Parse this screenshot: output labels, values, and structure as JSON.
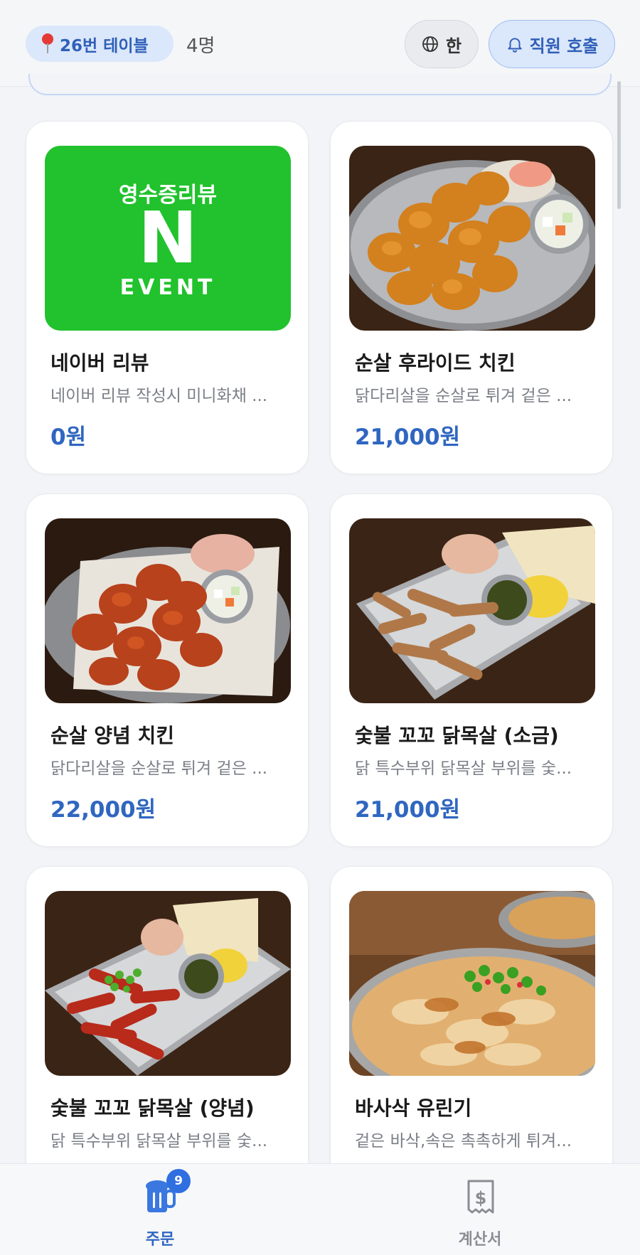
{
  "header": {
    "table_label": "26번 테이블",
    "people": "4명",
    "language": "한",
    "call_staff": "직원 호출"
  },
  "menu": [
    {
      "title": "네이버 리뷰",
      "desc": "네이버 리뷰 작성시 미니화채 ...",
      "price": "0원",
      "image": "naver-review-event"
    },
    {
      "title": "순살 후라이드 치킨",
      "desc": "닭다리살을 순살로 튀겨 겉은 ...",
      "price": "21,000원",
      "image": "fried-chicken-photo"
    },
    {
      "title": "순살 양념 치킨",
      "desc": "닭다리살을 순살로 튀겨 겉은 ...",
      "price": "22,000원",
      "image": "seasoned-chicken-photo"
    },
    {
      "title": "숯불 꼬꼬 닭목살 (소금)",
      "desc": "닭 특수부위 닭목살 부위를 숯...",
      "price": "21,000원",
      "image": "grilled-neck-salt-photo"
    },
    {
      "title": "숯불 꼬꼬 닭목살 (양념)",
      "desc": "닭 특수부위 닭목살 부위를 숯...",
      "price": "",
      "image": "grilled-neck-seasoned-photo"
    },
    {
      "title": "바사삭 유린기",
      "desc": "겉은 바삭,속은 촉촉하게 튀겨...",
      "price": "",
      "image": "yuringi-photo"
    }
  ],
  "naver_event": {
    "line1": "영수증리뷰",
    "logo": "N",
    "line2": "EVENT"
  },
  "bottom_nav": {
    "order_label": "주문",
    "order_badge": "9",
    "bill_label": "계산서"
  },
  "colors": {
    "accent": "#2f66c0",
    "naver_green": "#1ec31e",
    "pill_bg": "#dbe7fb"
  }
}
